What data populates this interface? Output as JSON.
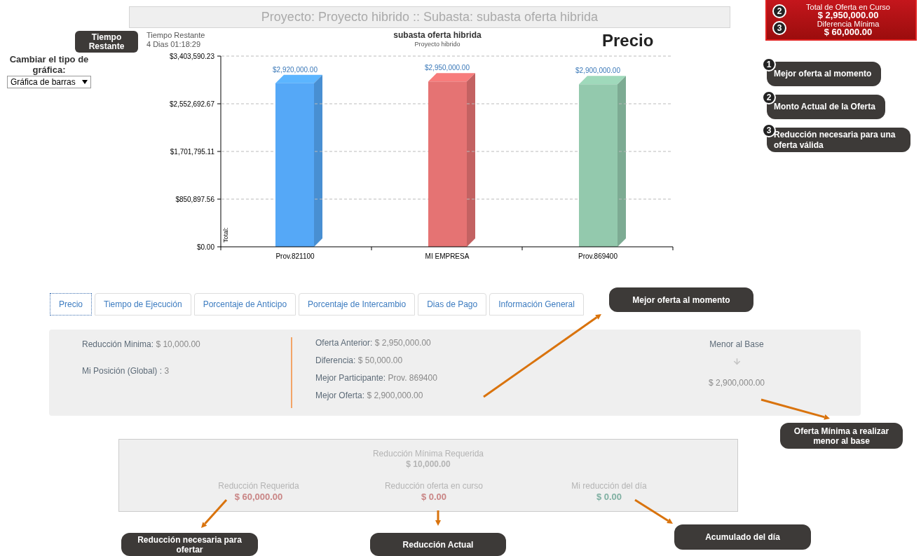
{
  "header": {
    "title": "Proyecto: Proyecto hibrido :: Subasta: subasta oferta hibrida"
  },
  "offer_summary": {
    "rows": [
      {
        "number": "2",
        "label": "Total de Oferta en Curso",
        "value": "$ 2,950,000.00"
      },
      {
        "number": "3",
        "label": "Diferencia Mínima",
        "value": "$ 60,000.00"
      }
    ]
  },
  "sidebar": {
    "time_badge": "Tiempo Restante",
    "chart_type_label": "Cambiar el tipo de gráfica:",
    "chart_type_select": {
      "value": "Gráfica de barras"
    }
  },
  "countdown": {
    "label": "Tiempo Restante",
    "value": "4 Dias 01:18:29"
  },
  "chart": {
    "heading": "Precio",
    "subtitle": "Proyecto hibrido",
    "bars": [
      {
        "color": "#55a8f7"
      },
      {
        "color": "#e57373"
      },
      {
        "color": "#93c9ad"
      }
    ],
    "chart_data": {
      "type": "bar",
      "grid": true,
      "title": "subasta oferta hibrida",
      "ylabel": "Total:",
      "categories": [
        "Prov.821100",
        "MI EMPRESA",
        "Prov.869400"
      ],
      "values": [
        2920000,
        2950000,
        2900000
      ],
      "ylim": [
        0,
        3403590.23
      ],
      "yticks": [
        {
          "value": 0,
          "label": "$0.00"
        },
        {
          "value": 850897.56,
          "label": "$850,897.56"
        },
        {
          "value": 1701795.11,
          "label": "$1,701,795.11"
        },
        {
          "value": 2552692.67,
          "label": "$2,552,692.67"
        },
        {
          "value": 3403590.23,
          "label": "$3,403,590.23"
        }
      ],
      "value_labels": [
        "$2,920,000.00",
        "$2,950,000.00",
        "$2,900,000.00"
      ]
    }
  },
  "legend": [
    {
      "number": "1",
      "text": "Mejor oferta al momento"
    },
    {
      "number": "2",
      "text": "Monto Actual de la Oferta"
    },
    {
      "number": "3",
      "text": "Reducción necesaria para una oferta válida"
    }
  ],
  "tabs": [
    {
      "label": "Precio",
      "selected": true
    },
    {
      "label": "Tiempo de Ejecución",
      "selected": false
    },
    {
      "label": "Porcentaje de Anticipo",
      "selected": false
    },
    {
      "label": "Porcentaje de Intercambio",
      "selected": false
    },
    {
      "label": "Dias de Pago",
      "selected": false
    },
    {
      "label": "Información General",
      "selected": false
    }
  ],
  "price_panel": {
    "left": [
      {
        "label": "Reducción Minima:",
        "value": "$ 10,000.00"
      },
      {
        "label": "Mi Posición (Global) :",
        "value": "3"
      }
    ],
    "middle": [
      {
        "label": "Oferta Anterior:",
        "value": "$ 2,950,000.00"
      },
      {
        "label": "Diferencia:",
        "value": "$ 50,000.00"
      },
      {
        "label": "Mejor Participante:",
        "value": "Prov. 869400"
      },
      {
        "label": "Mejor Oferta:",
        "value": "$ 2,900,000.00"
      }
    ],
    "base": {
      "label": "Menor al Base",
      "value": "$ 2,900,000.00"
    }
  },
  "reduction_box": {
    "title": "Reducción Mínima Requerida",
    "value": "$ 10,000.00",
    "columns": [
      {
        "label": "Reducción Requerida",
        "value": "$ 60,000.00",
        "color": "#c98585"
      },
      {
        "label": "Reducción oferta en curso",
        "value": "$ 0.00",
        "color": "#c98585"
      },
      {
        "label": "Mi reducción del día",
        "value": "$ 0.00",
        "color": "#7fb0a2"
      }
    ]
  },
  "callouts": [
    {
      "text": "Mejor oferta al momento"
    },
    {
      "text": "Oferta Mínima a realizar menor al base"
    },
    {
      "text": "Reducción necesaria para ofertar"
    },
    {
      "text": "Reducción Actual"
    },
    {
      "text": "Acumulado del día"
    }
  ]
}
